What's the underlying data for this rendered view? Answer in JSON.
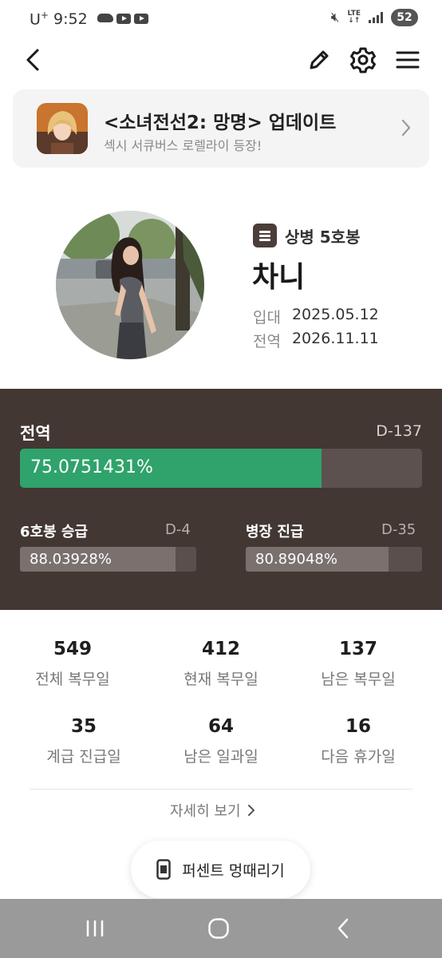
{
  "status_bar": {
    "carrier": "U",
    "carrier_sup": "+",
    "time": "9:52",
    "network": "LTE",
    "battery": "52"
  },
  "header": {
    "icons": [
      "back-arrow-icon",
      "pencil-icon",
      "gear-icon",
      "menu-icon"
    ]
  },
  "banner": {
    "title": "<소녀전선2: 망명> 업데이트",
    "subtitle": "섹시 서큐버스 로렐라이 등장!"
  },
  "profile": {
    "rank": "상병 5호봉",
    "name": "차니",
    "enlist_label": "입대",
    "enlist_date": "2025.05.12",
    "discharge_label": "전역",
    "discharge_date": "2026.11.11"
  },
  "progress": {
    "main": {
      "label": "전역",
      "dday": "D-137",
      "percent_text": "75.0751431%",
      "fraction": 0.7508
    },
    "promo": {
      "label": "6호봉 승급",
      "dday": "D-4",
      "percent_text": "88.03928%",
      "fraction": 0.8804
    },
    "rank_up": {
      "label": "병장 진급",
      "dday": "D-35",
      "percent_text": "80.89048%",
      "fraction": 0.8089
    }
  },
  "stats": [
    {
      "value": "549",
      "label": "전체 복무일"
    },
    {
      "value": "412",
      "label": "현재 복무일"
    },
    {
      "value": "137",
      "label": "남은 복무일"
    },
    {
      "value": "35",
      "label": "계급 진급일"
    },
    {
      "value": "64",
      "label": "남은 일과일"
    },
    {
      "value": "16",
      "label": "다음 휴가일"
    }
  ],
  "details_link": "자세히 보기",
  "fab_label": "퍼센트 멍때리기",
  "colors": {
    "panel_bg": "#423733",
    "progress_green": "#2fa36b"
  }
}
